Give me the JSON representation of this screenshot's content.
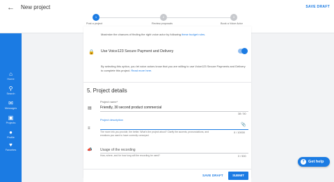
{
  "header": {
    "back_icon": "arrow-left-icon",
    "title": "New project",
    "save_draft": "SAVE DRAFT"
  },
  "stepper": {
    "steps": [
      {
        "number": "1",
        "label": "Post a project",
        "active": true
      },
      {
        "number": "2",
        "label": "Review proposals",
        "active": false
      },
      {
        "number": "3",
        "label": "Book a Voice Actor",
        "active": false
      }
    ]
  },
  "sidebar": {
    "items": [
      {
        "icon": "home-icon",
        "label": "Home"
      },
      {
        "icon": "search-icon",
        "label": "Search"
      },
      {
        "icon": "messages-icon",
        "label": "Messages"
      },
      {
        "icon": "projects-icon",
        "label": "Projects"
      },
      {
        "icon": "profile-icon",
        "label": "Profile"
      },
      {
        "icon": "favorites-icon",
        "label": "Favorites"
      }
    ]
  },
  "budget_tip": {
    "text": "Maximize the chances of finding the right voice actor by following ",
    "link": "these budget rules."
  },
  "secure_payment": {
    "lock_icon": "lock-icon",
    "label": "Use Voice123 Secure Payment and Delivery",
    "enabled": true,
    "description": "By selecting this option, you let voice actors know that you are willing to use Voice123 Secure Payments and Delivery to complete this project. ",
    "link": "Read more here."
  },
  "project_details": {
    "title": "5. Project details",
    "name_field": {
      "label": "Project name*",
      "value": "Friendly, 30 second product commercial",
      "counter": "38 / 50"
    },
    "description_field": {
      "label": "Project description",
      "helper": "The more info you provide, the better. What's the project about? Clarify the accents, pronunciations, and emotions you want to have correctly conveyed.",
      "counter": "0 / 10000"
    },
    "usage_field": {
      "label": "Usage of the recording",
      "helper": "How, where, and for how long will the recording be used?",
      "counter": "0 / 500"
    }
  },
  "footer": {
    "save_draft": "SAVE DRAFT",
    "submit": "SUBMIT"
  },
  "help": {
    "label": "Get help"
  },
  "colors": {
    "primary": "#1b7be3",
    "sidebar": "#1b7be3",
    "background": "#f2f3f5"
  }
}
